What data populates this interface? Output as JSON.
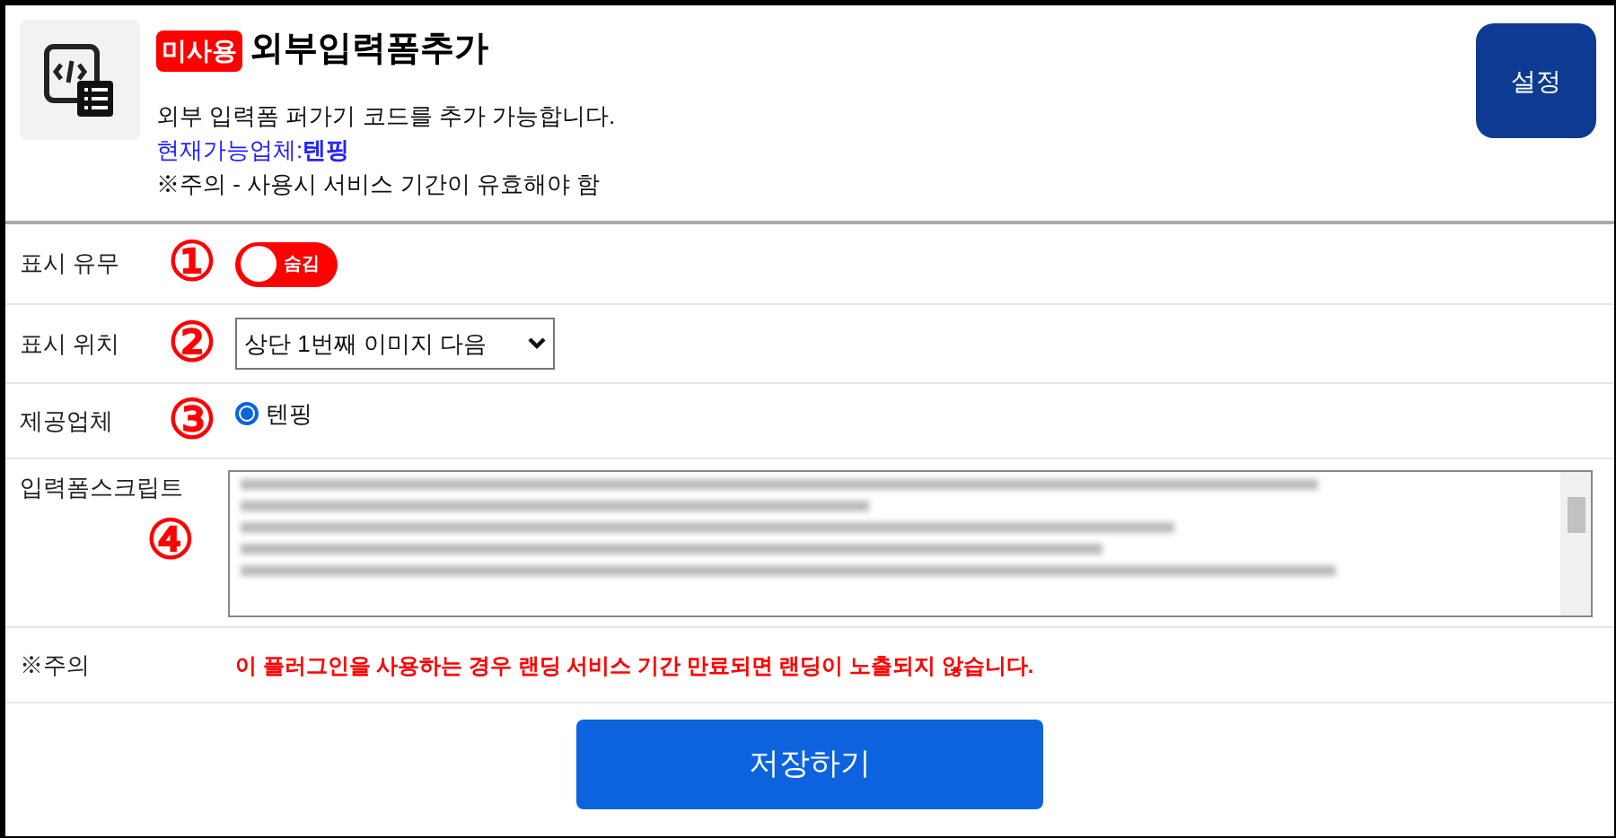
{
  "header": {
    "badge": "미사용",
    "title": "외부입력폼추가",
    "description": "외부 입력폼 퍼가기 코드를 추가 가능합니다.",
    "vendors_note": "현재가능업체:**텐핑**",
    "caution": "※주의 - 사용시 서비스 기간이 유효해야 함",
    "settings_button": "설정"
  },
  "rows": [
    {
      "kind": "toggle",
      "label": "표시 유무",
      "annotation": "①",
      "on": false,
      "toggle_text": "숨김"
    },
    {
      "kind": "select",
      "label": "표시 위치",
      "annotation": "②",
      "value": "상단 1번째 이미지 다음"
    },
    {
      "kind": "radio",
      "label": "제공업체",
      "annotation": "③",
      "options": [
        {
          "label": "텐핑",
          "selected": true
        }
      ]
    },
    {
      "kind": "script",
      "label": "입력폼스크립트",
      "annotation": "④"
    },
    {
      "kind": "warning",
      "label": "※주의",
      "text": "이 플러그인을 사용하는 경우 랜딩 서비스 기간 만료되면 랜딩이 노출되지 않습니다."
    }
  ],
  "save_button": "저장하기"
}
